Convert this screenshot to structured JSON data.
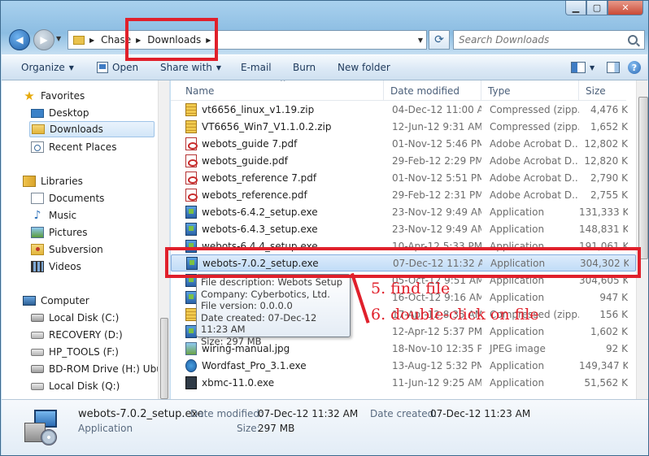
{
  "search": {
    "placeholder": "Search Downloads"
  },
  "address": {
    "segments": [
      "Chase",
      "Downloads"
    ]
  },
  "toolbar": {
    "organize": "Organize",
    "open": "Open",
    "share_with": "Share with",
    "email": "E-mail",
    "burn": "Burn",
    "new_folder": "New folder"
  },
  "nav": {
    "favorites": "Favorites",
    "desktop": "Desktop",
    "downloads": "Downloads",
    "recent": "Recent Places",
    "libraries": "Libraries",
    "documents": "Documents",
    "music": "Music",
    "pictures": "Pictures",
    "subversion": "Subversion",
    "videos": "Videos",
    "computer": "Computer",
    "drive_c": "Local Disk (C:)",
    "drive_d": "RECOVERY (D:)",
    "drive_f": "HP_TOOLS (F:)",
    "drive_h": "BD-ROM Drive (H:) Ubun",
    "drive_q": "Local Disk (Q:)"
  },
  "columns": {
    "name": "Name",
    "date": "Date modified",
    "type": "Type",
    "size": "Size"
  },
  "files": [
    {
      "name": "vt6656_linux_v1.19.zip",
      "date": "04-Dec-12 11:00 AM",
      "type": "Compressed (zipp...",
      "size": "4,476 K",
      "icon": "zip-icon"
    },
    {
      "name": "VT6656_Win7_V1.1.0.2.zip",
      "date": "12-Jun-12 9:31 AM",
      "type": "Compressed (zipp...",
      "size": "1,652 K",
      "icon": "zip-icon"
    },
    {
      "name": "webots_guide 7.pdf",
      "date": "01-Nov-12 5:46 PM",
      "type": "Adobe Acrobat D...",
      "size": "12,802 K",
      "icon": "pdf-icon"
    },
    {
      "name": "webots_guide.pdf",
      "date": "29-Feb-12 2:29 PM",
      "type": "Adobe Acrobat D...",
      "size": "12,820 K",
      "icon": "pdf-icon"
    },
    {
      "name": "webots_reference 7.pdf",
      "date": "01-Nov-12 5:51 PM",
      "type": "Adobe Acrobat D...",
      "size": "2,790 K",
      "icon": "pdf-icon"
    },
    {
      "name": "webots_reference.pdf",
      "date": "29-Feb-12 2:31 PM",
      "type": "Adobe Acrobat D...",
      "size": "2,755 K",
      "icon": "pdf-icon"
    },
    {
      "name": "webots-6.4.2_setup.exe",
      "date": "23-Nov-12 9:49 AM",
      "type": "Application",
      "size": "131,333 K",
      "icon": "exe-icon"
    },
    {
      "name": "webots-6.4.3_setup.exe",
      "date": "23-Nov-12 9:49 AM",
      "type": "Application",
      "size": "148,831 K",
      "icon": "exe-icon"
    },
    {
      "name": "webots-6.4.4_setup.exe",
      "date": "10-Apr-12 5:33 PM",
      "type": "Application",
      "size": "191,061 K",
      "icon": "exe-icon"
    },
    {
      "name": "webots-7.0.2_setup.exe",
      "date": "07-Dec-12 11:32 AM",
      "type": "Application",
      "size": "304,302 K",
      "icon": "exe-icon"
    },
    {
      "name": "",
      "date": "05-Oct-12 9:51 AM",
      "type": "Application",
      "size": "304,605 K",
      "icon": "exe-icon"
    },
    {
      "name": "",
      "date": "16-Oct-12 9:16 AM",
      "type": "Application",
      "size": "947 K",
      "icon": "exe-icon"
    },
    {
      "name": "",
      "date": "17-Apr-12 8:35 AM",
      "type": "Compressed (zipp...",
      "size": "156 K",
      "icon": "zip-icon"
    },
    {
      "name": "",
      "date": "12-Apr-12 5:37 PM",
      "type": "Application",
      "size": "1,602 K",
      "icon": "exe-icon"
    },
    {
      "name": "wiring-manual.jpg",
      "date": "18-Nov-10 12:35 PM",
      "type": "JPEG image",
      "size": "92 K",
      "icon": "jpg-icon"
    },
    {
      "name": "Wordfast_Pro_3.1.exe",
      "date": "13-Aug-12 5:32 PM",
      "type": "Application",
      "size": "149,347 K",
      "icon": "wordfast-icon"
    },
    {
      "name": "xbmc-11.0.exe",
      "date": "11-Jun-12 9:25 AM",
      "type": "Application",
      "size": "51,562 K",
      "icon": "xbmc-icon"
    }
  ],
  "tooltip": {
    "line1": "File description: Webots Setup",
    "line2": "Company: Cyberbotics, Ltd.",
    "line3": "File version: 0.0.0.0",
    "line4": "Date created: 07-Dec-12 11:23 AM",
    "line5": "Size: 297 MB"
  },
  "annotations": {
    "step5": "5. find file",
    "step6": "6. double-click on file"
  },
  "details": {
    "name": "webots-7.0.2_setup.exe",
    "type": "Application",
    "modified_label": "Date modified:",
    "modified_value": "07-Dec-12 11:32 AM",
    "size_label": "Size:",
    "size_value": "297 MB",
    "created_label": "Date created:",
    "created_value": "07-Dec-12 11:23 AM"
  },
  "colors": {
    "annotation_red": "#e0202b",
    "selection_blue": "#c1dcf7"
  }
}
